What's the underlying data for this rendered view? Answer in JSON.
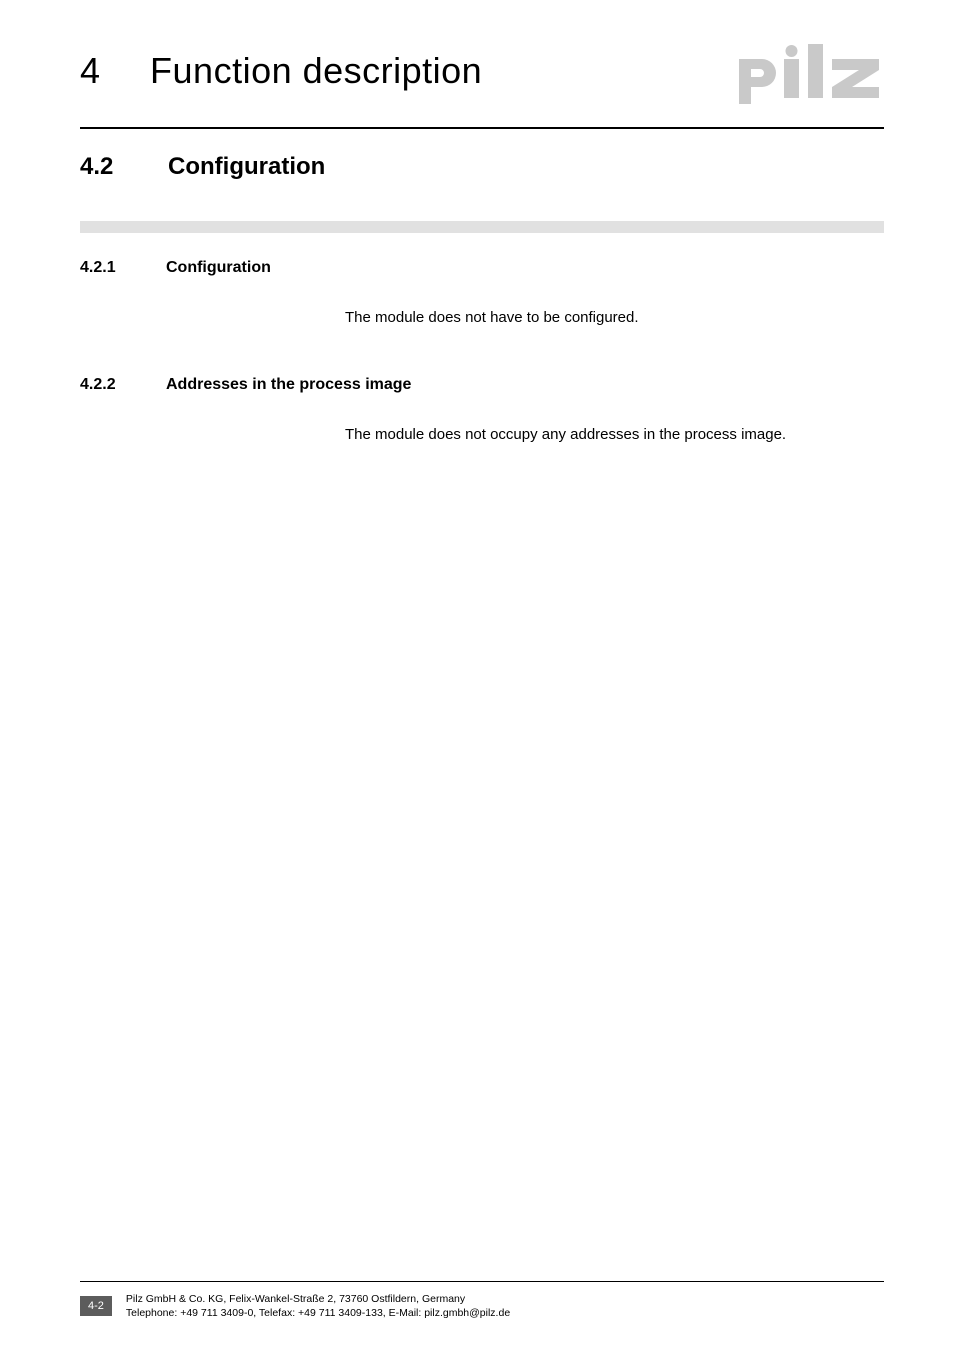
{
  "header": {
    "chapter_number": "4",
    "chapter_title": "Function description",
    "logo_name": "pilz"
  },
  "section": {
    "number": "4.2",
    "title": "Configuration"
  },
  "subsections": [
    {
      "number": "4.2.1",
      "title": "Configuration",
      "body": "The module does not have to be configured."
    },
    {
      "number": "4.2.2",
      "title": "Addresses in the process image",
      "body": "The module does not occupy any addresses in the process image."
    }
  ],
  "footer": {
    "page_number": "4-2",
    "line1": "Pilz GmbH & Co. KG, Felix-Wankel-Straße 2, 73760 Ostfildern, Germany",
    "line2": "Telephone: +49 711 3409-0, Telefax: +49 711 3409-133, E-Mail: pilz.gmbh@pilz.de"
  }
}
